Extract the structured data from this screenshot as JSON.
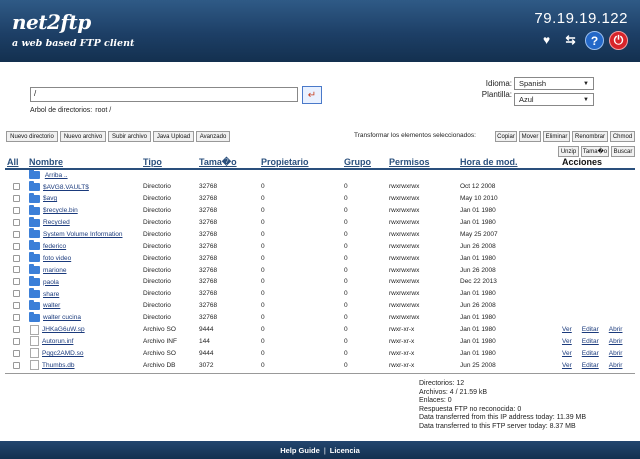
{
  "header": {
    "logo": "net2ftp",
    "tagline": "a web based FTP client",
    "ip": "79.19.19.122",
    "icons": [
      "bookmark-heart-icon",
      "refresh-icon",
      "help-icon",
      "logout-power-icon"
    ]
  },
  "nav": {
    "path_value": "/",
    "tree_label": "Arbol de directorios:",
    "tree_path": "root /"
  },
  "settings": {
    "language_label": "Idioma:",
    "language_value": "Spanish",
    "skin_label": "Plantilla:",
    "skin_value": "Azul"
  },
  "toolbar": {
    "new_dir": "Nuevo directorio",
    "new_file": "Nuevo archivo",
    "upload": "Subir archivo",
    "java_upload": "Java Upload",
    "advanced": "Avanzado",
    "transform_label": "Transformar los elementos seleccionados:",
    "copy": "Copiar",
    "move": "Mover",
    "delete": "Eliminar",
    "rename": "Renombrar",
    "chmod": "Chmod",
    "unzip": "Unzip",
    "size": "Tama�o",
    "search": "Buscar"
  },
  "table": {
    "headers": {
      "all": "All",
      "name": "Nombre",
      "type": "Tipo",
      "size": "Tama�o",
      "owner": "Propietario",
      "group": "Grupo",
      "perms": "Permisos",
      "mtime": "Hora de mod.",
      "actions": "Acciones"
    },
    "up_label": "Arriba ..",
    "rows": [
      {
        "name": "$AVG8.VAULT$",
        "type": "Directorio",
        "size": "32768",
        "owner": "0",
        "group": "0",
        "perms": "rwxrwxrwx",
        "mtime": "Oct 12 2008",
        "kind": "folder"
      },
      {
        "name": "$avg",
        "type": "Directorio",
        "size": "32768",
        "owner": "0",
        "group": "0",
        "perms": "rwxrwxrwx",
        "mtime": "May 10 2010",
        "kind": "folder"
      },
      {
        "name": "$recycle.bin",
        "type": "Directorio",
        "size": "32768",
        "owner": "0",
        "group": "0",
        "perms": "rwxrwxrwx",
        "mtime": "Jan 01 1980",
        "kind": "folder"
      },
      {
        "name": "Recycled",
        "type": "Directorio",
        "size": "32768",
        "owner": "0",
        "group": "0",
        "perms": "rwxrwxrwx",
        "mtime": "Jan 01 1980",
        "kind": "folder"
      },
      {
        "name": "System Volume Information",
        "type": "Directorio",
        "size": "32768",
        "owner": "0",
        "group": "0",
        "perms": "rwxrwxrwx",
        "mtime": "May 25 2007",
        "kind": "folder"
      },
      {
        "name": "federico",
        "type": "Directorio",
        "size": "32768",
        "owner": "0",
        "group": "0",
        "perms": "rwxrwxrwx",
        "mtime": "Jun 26 2008",
        "kind": "folder"
      },
      {
        "name": "foto video",
        "type": "Directorio",
        "size": "32768",
        "owner": "0",
        "group": "0",
        "perms": "rwxrwxrwx",
        "mtime": "Jan 01 1980",
        "kind": "folder"
      },
      {
        "name": "marione",
        "type": "Directorio",
        "size": "32768",
        "owner": "0",
        "group": "0",
        "perms": "rwxrwxrwx",
        "mtime": "Jun 26 2008",
        "kind": "folder"
      },
      {
        "name": "paola",
        "type": "Directorio",
        "size": "32768",
        "owner": "0",
        "group": "0",
        "perms": "rwxrwxrwx",
        "mtime": "Dec 22 2013",
        "kind": "folder"
      },
      {
        "name": "share",
        "type": "Directorio",
        "size": "32768",
        "owner": "0",
        "group": "0",
        "perms": "rwxrwxrwx",
        "mtime": "Jan 01 1980",
        "kind": "folder"
      },
      {
        "name": "walter",
        "type": "Directorio",
        "size": "32768",
        "owner": "0",
        "group": "0",
        "perms": "rwxrwxrwx",
        "mtime": "Jun 26 2008",
        "kind": "folder"
      },
      {
        "name": "walter cucina",
        "type": "Directorio",
        "size": "32768",
        "owner": "0",
        "group": "0",
        "perms": "rwxrwxrwx",
        "mtime": "Jan 01 1980",
        "kind": "folder"
      },
      {
        "name": "JHKaG6uW.sp",
        "type": "Archivo SO",
        "size": "9444",
        "owner": "0",
        "group": "0",
        "perms": "rwxr-xr-x",
        "mtime": "Jan 01 1980",
        "kind": "file"
      },
      {
        "name": "Autorun.inf",
        "type": "Archivo INF",
        "size": "144",
        "owner": "0",
        "group": "0",
        "perms": "rwxr-xr-x",
        "mtime": "Jan 01 1980",
        "kind": "file"
      },
      {
        "name": "Pqgc2AMD.so",
        "type": "Archivo SO",
        "size": "9444",
        "owner": "0",
        "group": "0",
        "perms": "rwxr-xr-x",
        "mtime": "Jan 01 1980",
        "kind": "file"
      },
      {
        "name": "Thumbs.db",
        "type": "Archivo DB",
        "size": "3072",
        "owner": "0",
        "group": "0",
        "perms": "rwxr-xr-x",
        "mtime": "Jun 25 2008",
        "kind": "file"
      }
    ],
    "file_actions": {
      "view": "Ver",
      "edit": "Editar",
      "open": "Abrir"
    }
  },
  "stats": {
    "dirs": "Directorios: 12",
    "files": "Archivos: 4 / 21.59 kB",
    "links": "Enlaces: 0",
    "unrecognized": "Respuesta FTP no reconocida: 0",
    "ip_today": "Data transferred from this IP address today: 11.39 MB",
    "server_today": "Data transferred to this FTP server today: 8.37 MB"
  },
  "footer": {
    "help": "Help Guide",
    "sep": "|",
    "license": "Licencia"
  }
}
